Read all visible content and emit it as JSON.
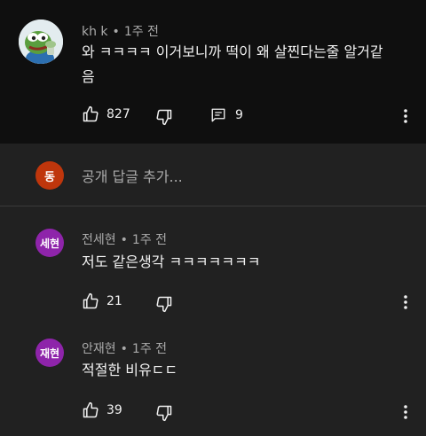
{
  "main_comment": {
    "author": "kh k",
    "separator": "•",
    "time": "1주 전",
    "text_line1": "와 ㅋㅋㅋㅋ 이거보니까 떡이 왜 살찐다는줄 알거같",
    "text_line2": "음",
    "likes": "827",
    "replies": "9",
    "icons": [
      "like-icon",
      "dislike-icon",
      "reply-icon",
      "more-vert-icon"
    ]
  },
  "reply_box": {
    "avatar_initial": "동",
    "avatar_color": "#bf360c",
    "placeholder": "공개 답글 추가..."
  },
  "replies": [
    {
      "avatar": "세현",
      "avatar_color": "#8e24aa",
      "author": "전세현",
      "time": "1주 전",
      "text": "저도 같은생각 ㅋㅋㅋㅋㅋㅋㅋ",
      "likes": "21"
    },
    {
      "avatar": "재현",
      "avatar_color": "#8e24aa",
      "author": "안재현",
      "time": "1주 전",
      "text": "적절한 비유ㄷㄷ",
      "likes": "39"
    }
  ],
  "colors": {
    "top_bg": "#0f0f0f",
    "page_bg": "#212121",
    "text": "#f1f1f1",
    "meta": "#aaaaaa"
  }
}
